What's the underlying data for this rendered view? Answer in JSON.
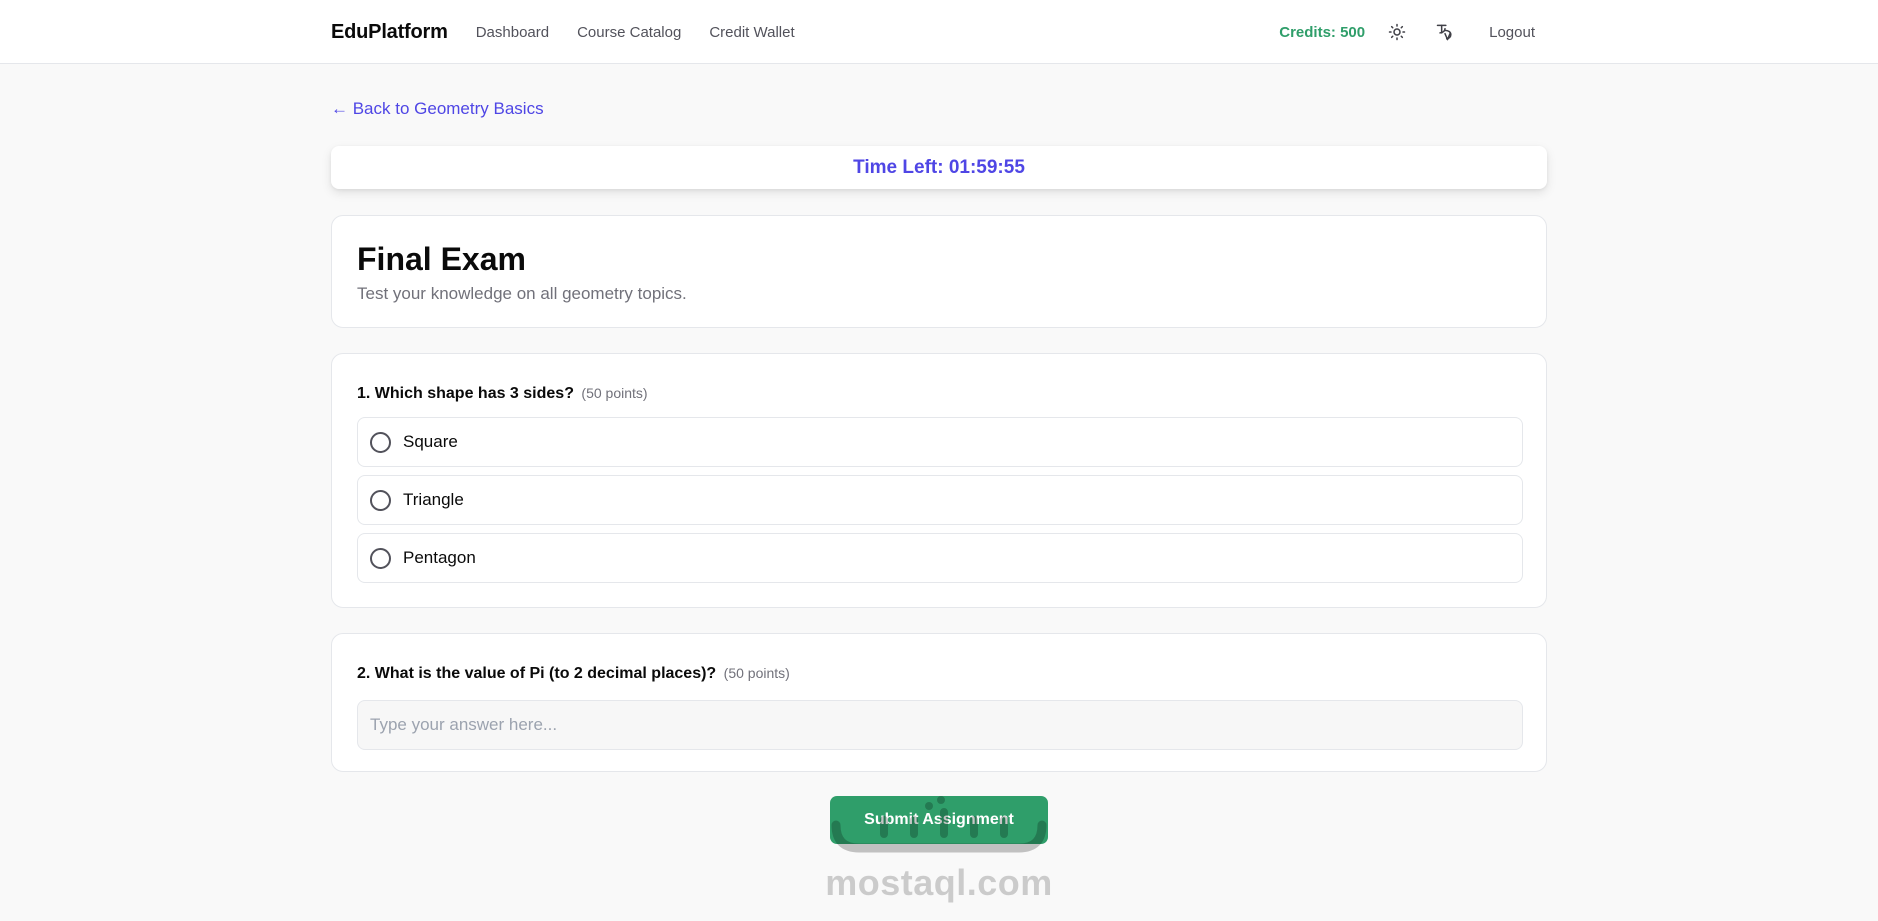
{
  "nav": {
    "brand": "EduPlatform",
    "links": [
      "Dashboard",
      "Course Catalog",
      "Credit Wallet"
    ],
    "credits": "Credits: 500",
    "logout": "Logout",
    "icons": [
      "sun-icon",
      "translate-icon"
    ]
  },
  "back_link": "← Back to Geometry Basics",
  "timer": "Time Left: 01:59:55",
  "exam": {
    "title": "Final Exam",
    "description": "Test your knowledge on all geometry topics."
  },
  "questions": [
    {
      "title": "1. Which shape has 3 sides?",
      "points": "(50 points)",
      "options": [
        "Square",
        "Triangle",
        "Pentagon"
      ]
    },
    {
      "title": "2. What is the value of Pi (to 2 decimal places)?",
      "points": "(50 points)",
      "input_value": "",
      "placeholder": "Type your answer here..."
    }
  ],
  "submit": "Submit Assignment",
  "watermark": "mostaql.com",
  "colors": {
    "accent": "#4f46e5",
    "success": "#2f9e6a",
    "border": "#e5e7eb",
    "background": "#f9f9f9"
  }
}
